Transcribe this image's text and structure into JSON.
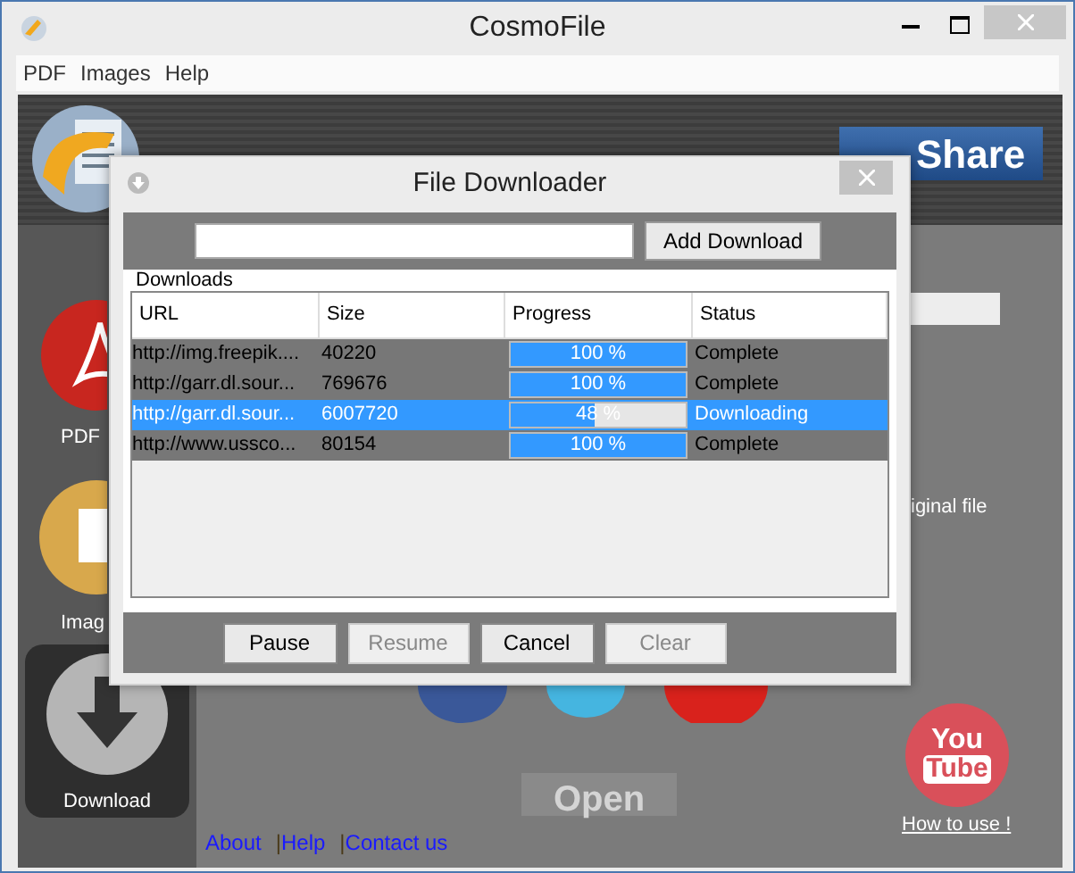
{
  "window": {
    "title": "CosmoFile"
  },
  "menu": [
    "PDF",
    "Images",
    "Help"
  ],
  "share_button": {
    "label": "Share"
  },
  "sidebar": {
    "items": [
      {
        "kind": "pdf",
        "label": "PDF",
        "selected": false
      },
      {
        "kind": "images",
        "label": "Imag",
        "selected": false
      },
      {
        "kind": "download",
        "label": "Download",
        "selected": true
      }
    ]
  },
  "main": {
    "note": "iginal file",
    "open_button": {
      "label": "Open",
      "disabled": true
    },
    "youtube": {
      "line_1": "You",
      "line_2": "Tube"
    },
    "how_to_use": "How to use !",
    "links": [
      {
        "label": "About"
      },
      {
        "separator": "|",
        "label": "Help"
      },
      {
        "separator": "|",
        "label": "Contact us"
      }
    ]
  },
  "dialog": {
    "title": "File Downloader",
    "add_button": "Add Download",
    "group_label": "Downloads",
    "table": {
      "columns": [
        "URL",
        "Size",
        "Progress",
        "Status"
      ],
      "rows": [
        {
          "url": "http://img.freepik....",
          "size": "40220",
          "progress": "100 %",
          "level": 1,
          "status": "Complete",
          "selected": false
        },
        {
          "url": "http://garr.dl.sour...",
          "size": "769676",
          "progress": "100 %",
          "level": 1,
          "status": "Complete",
          "selected": false
        },
        {
          "url": "http://garr.dl.sour...",
          "size": "6007720",
          "progress": "48 %",
          "level": 0.48,
          "status": "Downloading",
          "selected": true
        },
        {
          "url": "http://www.ussco...",
          "size": "80154",
          "progress": "100 %",
          "level": 1,
          "status": "Complete",
          "selected": false
        }
      ]
    },
    "buttons": [
      {
        "label": "Pause",
        "disabled": false
      },
      {
        "label": "Resume",
        "disabled": true
      },
      {
        "label": "Cancel",
        "disabled": false
      },
      {
        "label": "Clear",
        "disabled": true
      }
    ]
  }
}
